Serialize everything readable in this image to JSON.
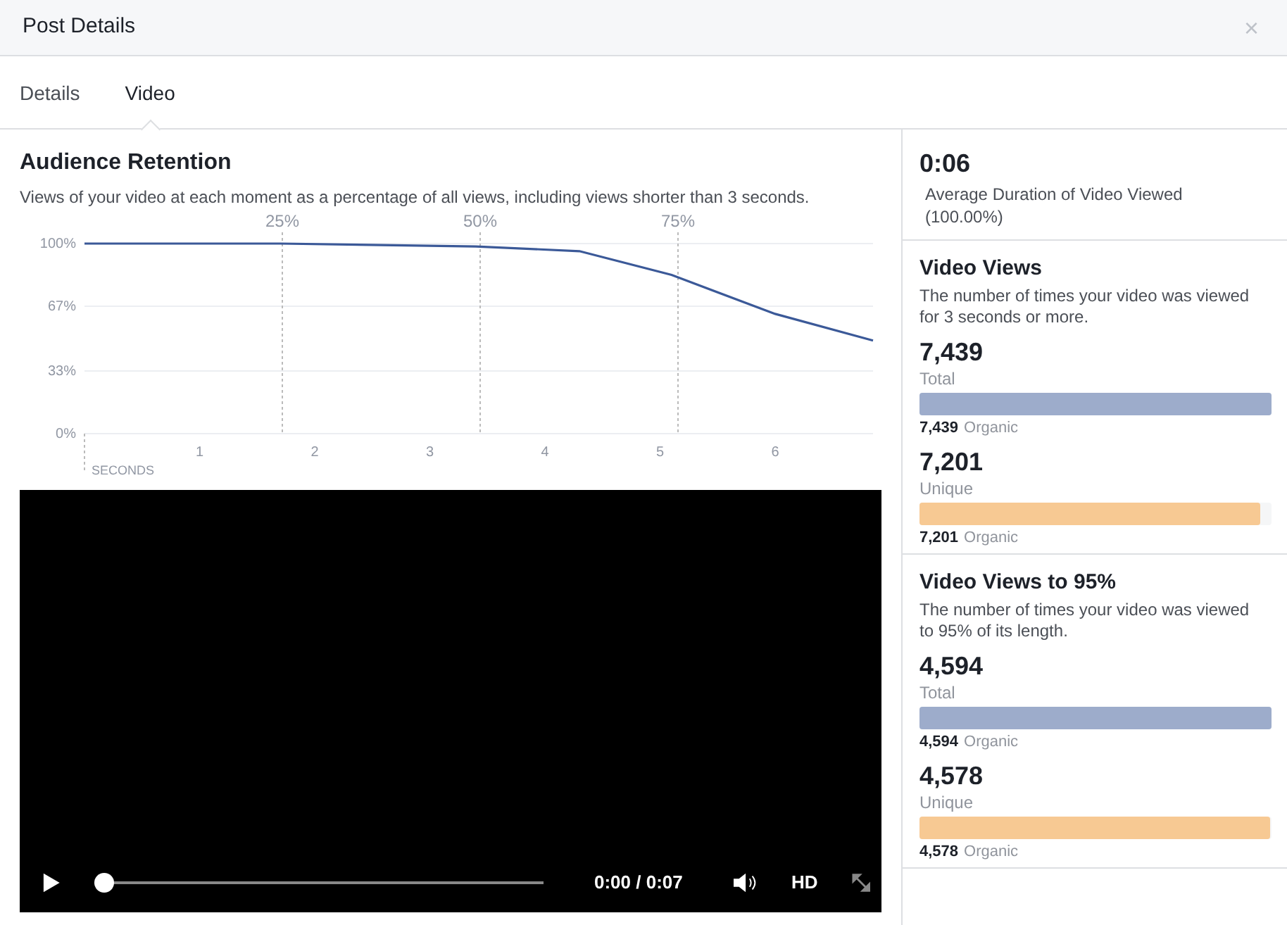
{
  "window": {
    "title": "Post Details",
    "close": "×"
  },
  "tabs": [
    {
      "label": "Details",
      "selected": false
    },
    {
      "label": "Video",
      "selected": true
    }
  ],
  "retention": {
    "title": "Audience Retention",
    "description": "Views of your video at each moment as a percentage of all views, including views shorter than 3 seconds.",
    "chart_data": {
      "type": "line",
      "xlabel": "SECONDS",
      "x": [
        0,
        1.7,
        3.4,
        4.3,
        5.1,
        6,
        6.85
      ],
      "series": [
        {
          "color": "#3b5998",
          "values": [
            100,
            100,
            98.5,
            96,
            83.5,
            63,
            49
          ]
        }
      ],
      "xlim": [
        0,
        6.85
      ],
      "ylim": [
        0,
        100
      ],
      "xticks": [
        1,
        2,
        3,
        4,
        5,
        6
      ],
      "yticks": [
        {
          "value": 0,
          "label": "0%"
        },
        {
          "value": 33,
          "label": "33%"
        },
        {
          "value": 67,
          "label": "67%"
        },
        {
          "value": 100,
          "label": "100%"
        }
      ]
    },
    "markers": [
      "25%",
      "50%",
      "75%"
    ]
  },
  "player": {
    "time": "0:00 / 0:07",
    "quality": "HD",
    "level": 0
  },
  "summary": {
    "value": "0:06",
    "label": "Average Duration of Video Viewed (100.00%)"
  },
  "sections": [
    {
      "title": "Video Views",
      "description": "The number of times your video was viewed for 3 seconds or more.",
      "metrics": [
        {
          "value": "7,439",
          "label": "Total",
          "color": "#9daccb",
          "level": 1,
          "breakdown_value": "7,439",
          "breakdown_label": "Organic"
        },
        {
          "value": "7,201",
          "label": "Unique",
          "color": "#f7c993",
          "level": 0.968,
          "breakdown_value": "7,201",
          "breakdown_label": "Organic"
        }
      ]
    },
    {
      "title": "Video Views to 95%",
      "description": "The number of times your video was viewed to 95% of its length.",
      "metrics": [
        {
          "value": "4,594",
          "label": "Total",
          "color": "#9daccb",
          "level": 1,
          "breakdown_value": "4,594",
          "breakdown_label": "Organic"
        },
        {
          "value": "4,578",
          "label": "Unique",
          "color": "#f7c993",
          "level": 0.997,
          "breakdown_value": "4,578",
          "breakdown_label": "Organic"
        }
      ]
    }
  ]
}
